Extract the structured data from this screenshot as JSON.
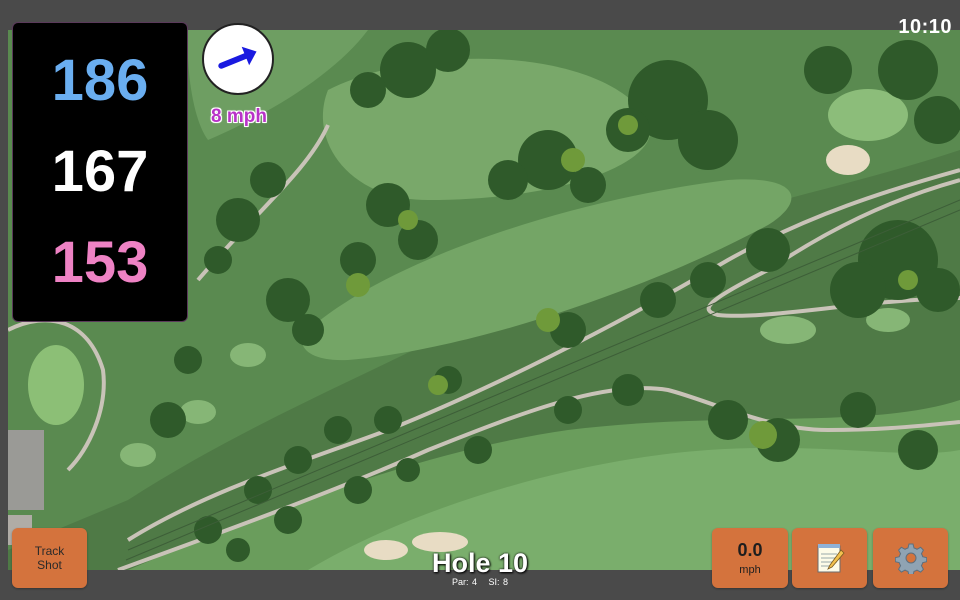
{
  "clock": "10:10",
  "distances": {
    "back": "186",
    "middle": "167",
    "front": "153",
    "colors": {
      "back": "#6aaef0",
      "middle": "#ffffff",
      "front": "#ee82c4"
    }
  },
  "wind": {
    "speed": "8 mph",
    "direction_icon": "wind-arrow-icon",
    "arrow_color": "#1a1ae0"
  },
  "buttons": {
    "track_shot_line1": "Track",
    "track_shot_line2": "Shot",
    "speed_value": "0.0",
    "speed_unit": "mph",
    "notes_icon": "notepad-icon",
    "settings_icon": "gear-icon",
    "accent": "#d4733d"
  },
  "hole": {
    "title": "Hole 10",
    "par": "Par: 4",
    "si": "SI: 8"
  }
}
